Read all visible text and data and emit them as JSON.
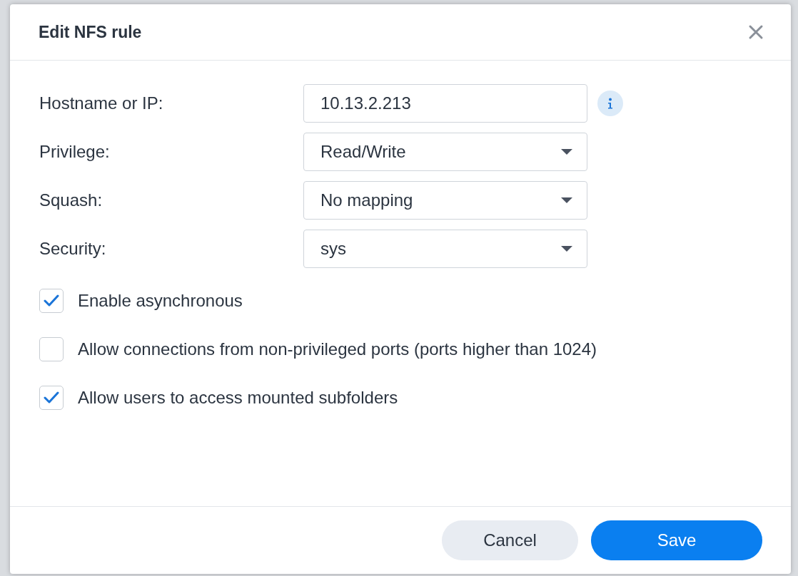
{
  "dialog": {
    "title": "Edit NFS rule"
  },
  "fields": [
    {
      "kind": "text",
      "label": "Hostname or IP:",
      "value": "10.13.2.213"
    },
    {
      "kind": "select",
      "label": "Privilege:",
      "value": "Read/Write"
    },
    {
      "kind": "select",
      "label": "Squash:",
      "value": "No mapping"
    },
    {
      "kind": "select",
      "label": "Security:",
      "value": "sys"
    }
  ],
  "options": [
    {
      "label": "Enable asynchronous",
      "checked": true
    },
    {
      "label": "Allow connections from non-privileged ports (ports higher than 1024)",
      "checked": false
    },
    {
      "label": "Allow users to access mounted subfolders",
      "checked": true
    }
  ],
  "buttons": [
    {
      "label": "Cancel",
      "kind": "secondary"
    },
    {
      "label": "Save",
      "kind": "primary"
    }
  ]
}
